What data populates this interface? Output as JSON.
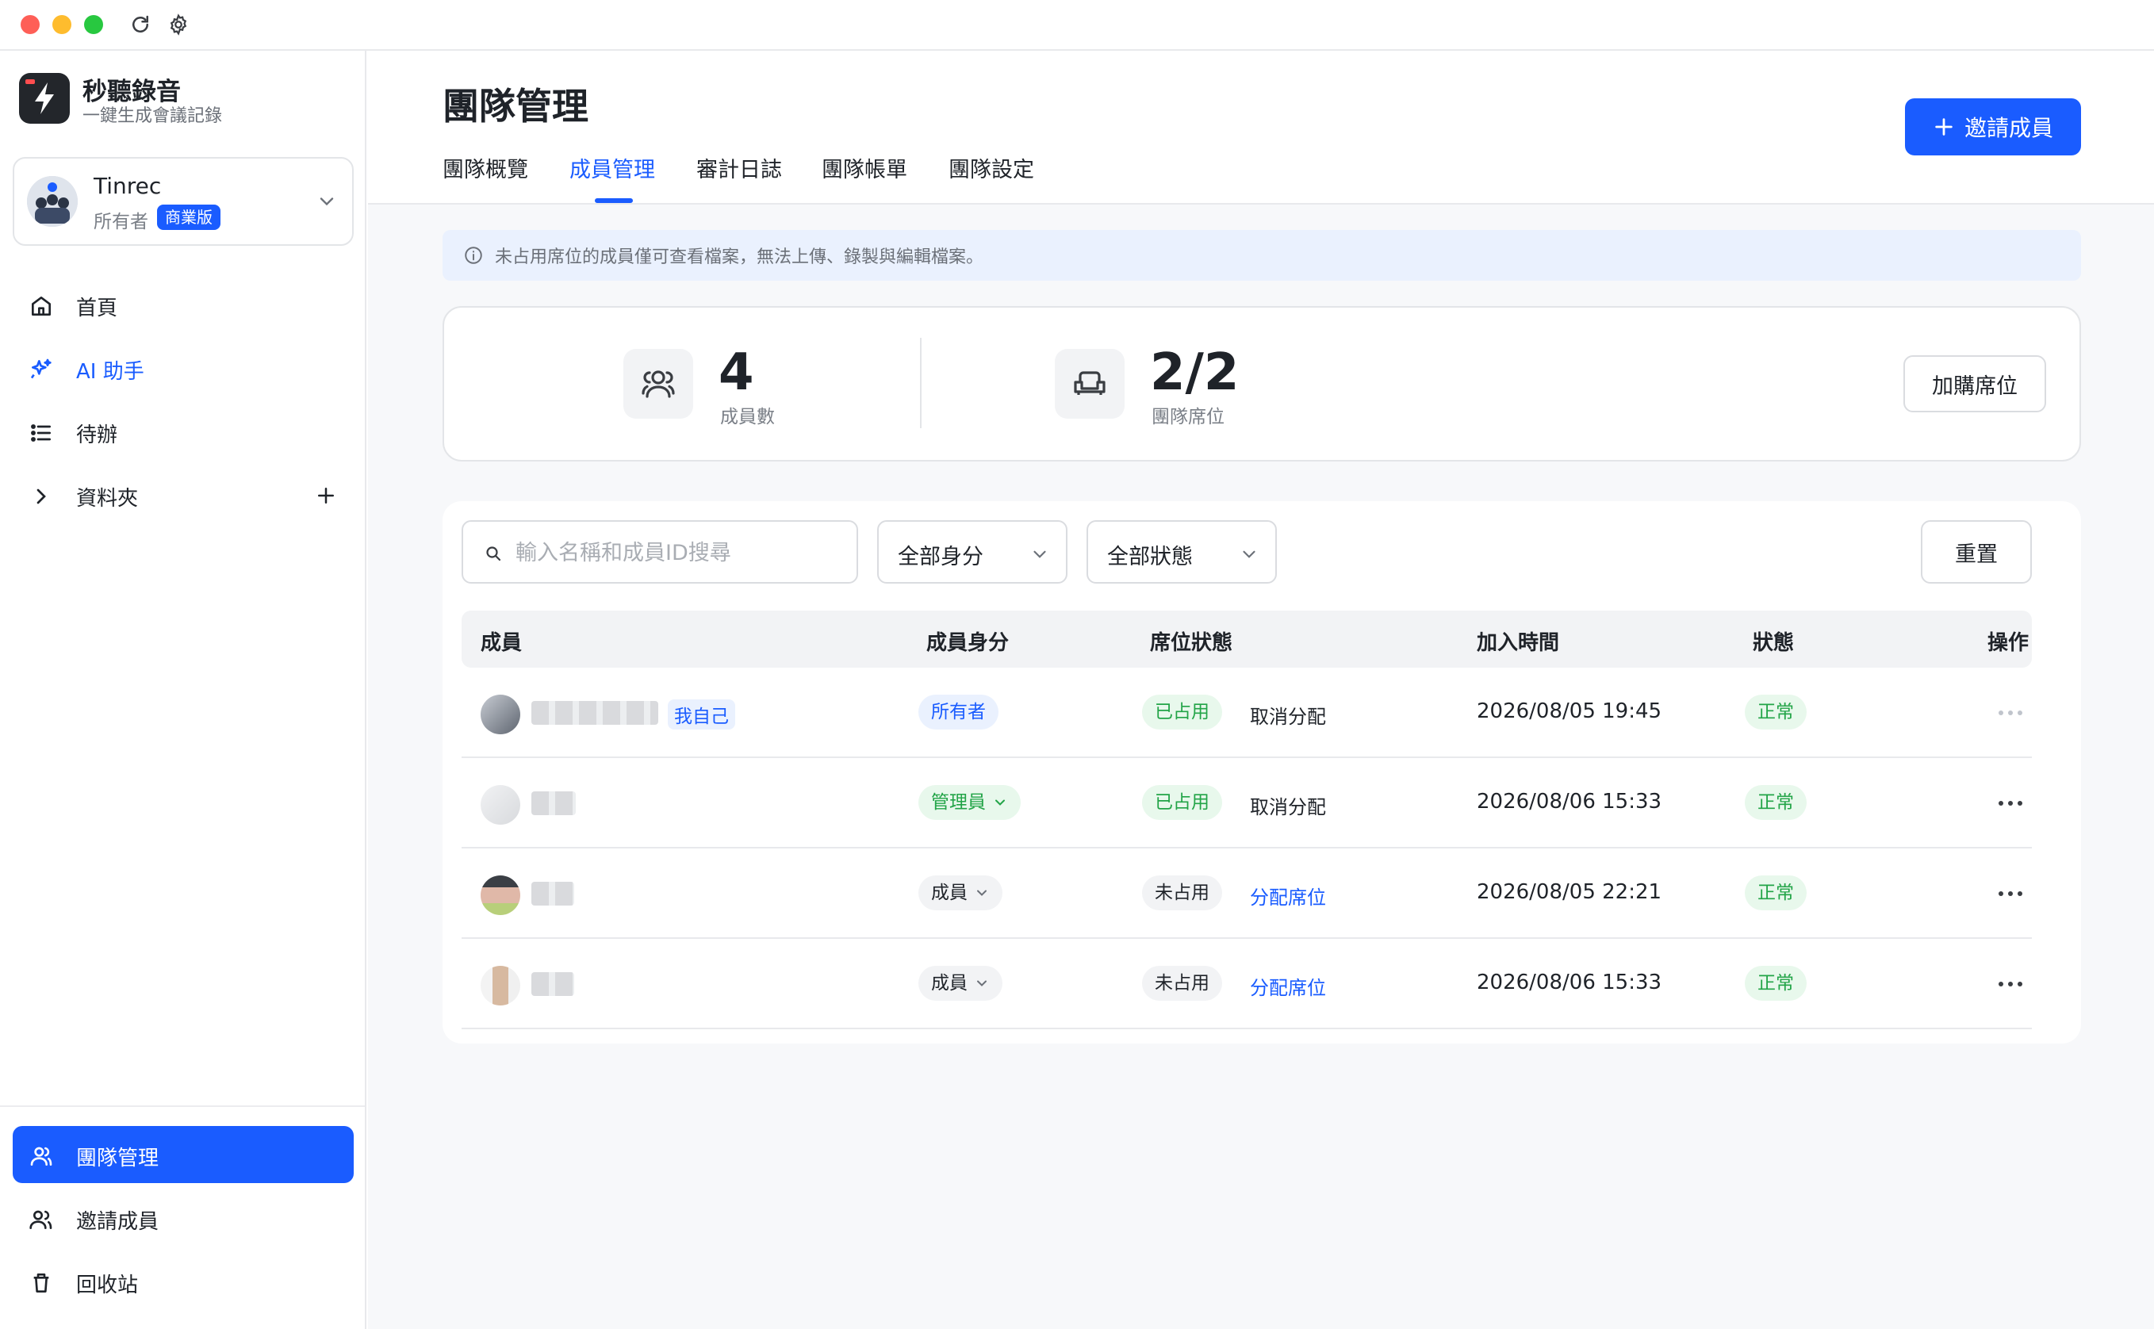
{
  "brand": {
    "name": "秒聽錄音",
    "tagline": "一鍵生成會議記錄"
  },
  "team": {
    "name": "Tinrec",
    "role": "所有者",
    "plan": "商業版"
  },
  "sidebar": {
    "items": [
      {
        "label": "首頁",
        "icon": "home-icon"
      },
      {
        "label": "AI 助手",
        "icon": "sparkles-icon"
      },
      {
        "label": "待辦",
        "icon": "list-icon"
      },
      {
        "label": "資料夾",
        "icon": "chevron-right-icon"
      }
    ],
    "bottom_items": [
      {
        "label": "團隊管理",
        "icon": "team-icon",
        "active": true
      },
      {
        "label": "邀請成員",
        "icon": "users-icon"
      },
      {
        "label": "回收站",
        "icon": "trash-icon"
      }
    ]
  },
  "header": {
    "title": "團隊管理",
    "tabs": [
      {
        "label": "團隊概覽"
      },
      {
        "label": "成員管理",
        "active": true
      },
      {
        "label": "審計日誌"
      },
      {
        "label": "團隊帳單"
      },
      {
        "label": "團隊設定"
      }
    ],
    "invite_label": "邀請成員"
  },
  "notice": "未占用席位的成員僅可查看檔案，無法上傳、錄製與編輯檔案。",
  "stats": {
    "members": {
      "value": "4",
      "label": "成員數"
    },
    "seats": {
      "value": "2/2",
      "label": "團隊席位"
    },
    "buy_label": "加購席位"
  },
  "filters": {
    "search_placeholder": "輸入名稱和成員ID搜尋",
    "role_select": "全部身分",
    "status_select": "全部狀態",
    "reset_label": "重置"
  },
  "table": {
    "columns": [
      "成員",
      "成員身分",
      "席位狀態",
      "加入時間",
      "狀態",
      "操作"
    ],
    "rows": [
      {
        "self_tag": "我自己",
        "role": "所有者",
        "seat": "已占用",
        "seat_action": "取消分配",
        "joined": "2026/08/05 19:45",
        "status": "正常"
      },
      {
        "self_tag": "",
        "role": "管理員",
        "seat": "已占用",
        "seat_action": "取消分配",
        "joined": "2026/08/06 15:33",
        "status": "正常"
      },
      {
        "self_tag": "",
        "role": "成員",
        "seat": "未占用",
        "seat_action": "分配席位",
        "joined": "2026/08/05 22:21",
        "status": "正常"
      },
      {
        "self_tag": "",
        "role": "成員",
        "seat": "未占用",
        "seat_action": "分配席位",
        "joined": "2026/08/06 15:33",
        "status": "正常"
      }
    ]
  },
  "colors": {
    "accent": "#1a5cff",
    "success": "#22a447",
    "success_bg": "#e8f8ec",
    "info_bg": "#eaf1fe"
  }
}
